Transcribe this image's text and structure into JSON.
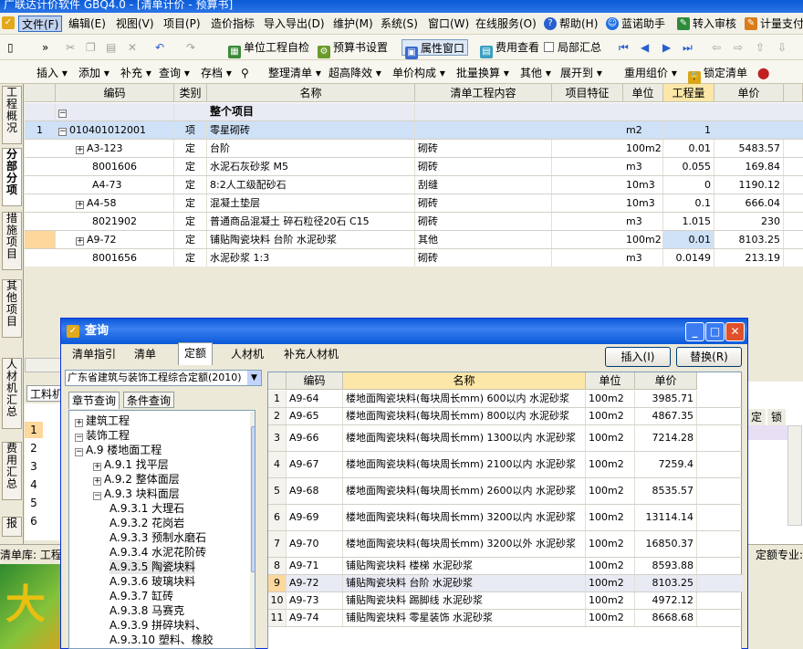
{
  "window": {
    "title": "广联达计价软件 GBQ4.0 - [清单计价 - 预算书]"
  },
  "menu": [
    "文件(F)",
    "编辑(E)",
    "视图(V)",
    "项目(P)",
    "造价指标",
    "导入导出(D)",
    "维护(M)",
    "系统(S)",
    "窗口(W)",
    "在线服务(O)",
    "帮助(H)",
    "蓝诺助手",
    "转入审核",
    "计量支付"
  ],
  "toolbar1": {
    "self_check": "单位工程自检",
    "budget_settings": "预算书设置",
    "property_window": "属性窗口",
    "fee_view": "费用查看",
    "partial_summary": "局部汇总"
  },
  "toolbar2": [
    "插入",
    "添加",
    "补充",
    "查询",
    "存档",
    "整理清单",
    "超高降效",
    "单价构成",
    "批量换算",
    "其他",
    "展开到",
    "重用组价",
    "锁定清单"
  ],
  "left_tabs": [
    "工程概况",
    "分部分项",
    "措施项目",
    "其他项目",
    "人材机汇总",
    "费用汇总",
    "报"
  ],
  "grid": {
    "headers": [
      "编码",
      "类别",
      "名称",
      "清单工程内容",
      "项目特征",
      "单位",
      "工程量",
      "单价"
    ],
    "rows": [
      {
        "n": "",
        "code": "",
        "type": "",
        "name": "整个项目",
        "content": "",
        "unit": "",
        "qty": "",
        "price": ""
      },
      {
        "n": "1",
        "code": "010401012001",
        "type": "项",
        "name": "零星砌砖",
        "content": "",
        "unit": "m2",
        "qty": "1",
        "price": ""
      },
      {
        "n": "",
        "code": "A3-123",
        "type": "定",
        "name": "台阶",
        "content": "砌砖",
        "unit": "100m2",
        "qty": "0.01",
        "price": "5483.57"
      },
      {
        "n": "",
        "code": "8001606",
        "type": "定",
        "name": "水泥石灰砂浆 M5",
        "content": "砌砖",
        "unit": "m3",
        "qty": "0.055",
        "price": "169.84"
      },
      {
        "n": "",
        "code": "A4-73",
        "type": "定",
        "name": "8:2人工级配砂石",
        "content": "刮缝",
        "unit": "10m3",
        "qty": "0",
        "price": "1190.12"
      },
      {
        "n": "",
        "code": "A4-58",
        "type": "定",
        "name": "混凝土垫层",
        "content": "砌砖",
        "unit": "10m3",
        "qty": "0.1",
        "price": "666.04"
      },
      {
        "n": "",
        "code": "8021902",
        "type": "定",
        "name": "普通商品混凝土 碎石粒径20石 C15",
        "content": "砌砖",
        "unit": "m3",
        "qty": "1.015",
        "price": "230"
      },
      {
        "n": "",
        "code": "A9-72",
        "type": "定",
        "name": "铺贴陶瓷块料 台阶 水泥砂浆",
        "content": "其他",
        "unit": "100m2",
        "qty": "0.01",
        "price": "8103.25"
      },
      {
        "n": "",
        "code": "8001656",
        "type": "定",
        "name": "水泥砂浆 1:3",
        "content": "砌砖",
        "unit": "m3",
        "qty": "0.0149",
        "price": "213.19"
      }
    ]
  },
  "partial_tab": "工料机",
  "background_rows": [
    "1",
    "2",
    "3",
    "4",
    "5",
    "6"
  ],
  "right_header": [
    "定",
    "锁"
  ],
  "status": {
    "left": "清单库: 工程",
    "right": "定额专业:"
  },
  "desktop_text": "大",
  "dialog": {
    "title": "查询",
    "tabs": [
      "清单指引",
      "清单",
      "定额",
      "人材机",
      "补充人材机"
    ],
    "insert_button": "插入(I)",
    "replace_button": "替换(R)",
    "library": "广东省建筑与装饰工程综合定额(2010)",
    "subtabs": [
      "章节查询",
      "条件查询"
    ],
    "tree": [
      {
        "level": 0,
        "box": "+",
        "label": "建筑工程"
      },
      {
        "level": 0,
        "box": "-",
        "label": "装饰工程"
      },
      {
        "level": 1,
        "box": "-",
        "label": "A.9 楼地面工程"
      },
      {
        "level": 2,
        "box": "+",
        "label": "A.9.1 找平层"
      },
      {
        "level": 2,
        "box": "+",
        "label": "A.9.2 整体面层"
      },
      {
        "level": 2,
        "box": "-",
        "label": "A.9.3 块料面层"
      },
      {
        "level": 3,
        "box": "",
        "label": "A.9.3.1 大理石"
      },
      {
        "level": 3,
        "box": "",
        "label": "A.9.3.2 花岗岩"
      },
      {
        "level": 3,
        "box": "",
        "label": "A.9.3.3 预制水磨石"
      },
      {
        "level": 3,
        "box": "",
        "label": "A.9.3.4 水泥花阶砖"
      },
      {
        "level": 3,
        "box": "",
        "label": "A.9.3.5 陶瓷块料"
      },
      {
        "level": 3,
        "box": "",
        "label": "A.9.3.6 玻璃块料"
      },
      {
        "level": 3,
        "box": "",
        "label": "A.9.3.7 缸砖"
      },
      {
        "level": 3,
        "box": "",
        "label": "A.9.3.8 马赛克"
      },
      {
        "level": 3,
        "box": "",
        "label": "A.9.3.9 拼碎块料、"
      },
      {
        "level": 3,
        "box": "",
        "label": "A.9.3.10 塑料、橡胶"
      }
    ],
    "tree_selected": 10,
    "result_headers": [
      "编码",
      "名称",
      "单位",
      "单价"
    ],
    "results": [
      {
        "n": "1",
        "code": "A9-64",
        "name": "楼地面陶瓷块料(每块周长mm) 600以内 水泥砂浆",
        "unit": "100m2",
        "price": "3985.71"
      },
      {
        "n": "2",
        "code": "A9-65",
        "name": "楼地面陶瓷块料(每块周长mm) 800以内 水泥砂浆",
        "unit": "100m2",
        "price": "4867.35"
      },
      {
        "n": "3",
        "code": "A9-66",
        "name": "楼地面陶瓷块料(每块周长mm) 1300以内 水泥砂浆",
        "unit": "100m2",
        "price": "7214.28"
      },
      {
        "n": "4",
        "code": "A9-67",
        "name": "楼地面陶瓷块料(每块周长mm) 2100以内 水泥砂浆",
        "unit": "100m2",
        "price": "7259.4"
      },
      {
        "n": "5",
        "code": "A9-68",
        "name": "楼地面陶瓷块料(每块周长mm) 2600以内 水泥砂浆",
        "unit": "100m2",
        "price": "8535.57"
      },
      {
        "n": "6",
        "code": "A9-69",
        "name": "楼地面陶瓷块料(每块周长mm) 3200以内 水泥砂浆",
        "unit": "100m2",
        "price": "13114.14"
      },
      {
        "n": "7",
        "code": "A9-70",
        "name": "楼地面陶瓷块料(每块周长mm) 3200以外 水泥砂浆",
        "unit": "100m2",
        "price": "16850.37"
      },
      {
        "n": "8",
        "code": "A9-71",
        "name": "铺贴陶瓷块料 楼梯 水泥砂浆",
        "unit": "100m2",
        "price": "8593.88"
      },
      {
        "n": "9",
        "code": "A9-72",
        "name": "铺贴陶瓷块料 台阶 水泥砂浆",
        "unit": "100m2",
        "price": "8103.25"
      },
      {
        "n": "10",
        "code": "A9-73",
        "name": "铺贴陶瓷块料 踢脚线 水泥砂浆",
        "unit": "100m2",
        "price": "4972.12"
      },
      {
        "n": "11",
        "code": "A9-74",
        "name": "铺贴陶瓷块料 零星装饰 水泥砂浆",
        "unit": "100m2",
        "price": "8668.68"
      }
    ],
    "result_selected": 8
  },
  "colors": {
    "title_blue": "#0a5bd8",
    "highlight_header": "#fde7a8",
    "selected_row": "#cfe1f7",
    "orange_row": "#fdd79b"
  }
}
